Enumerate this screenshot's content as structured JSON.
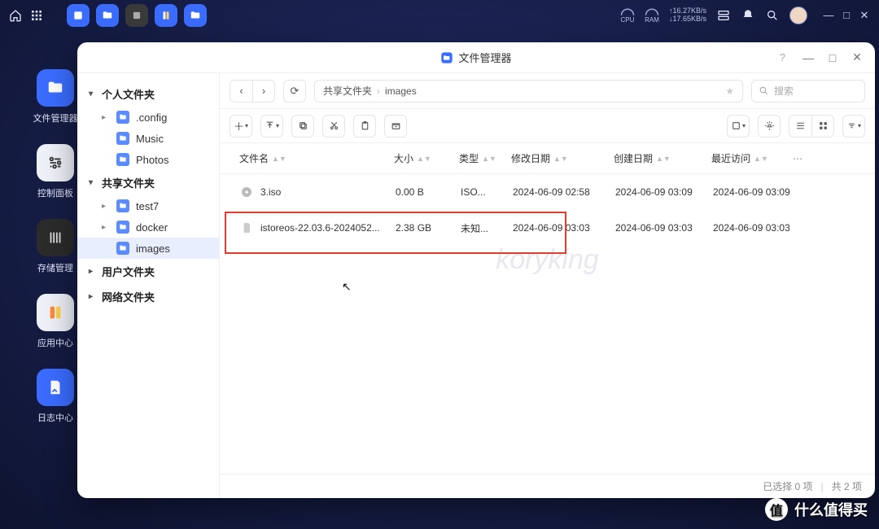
{
  "topbar": {
    "cpu_label": "CPU",
    "ram_label": "RAM",
    "net_up": "↑16.27KB/s",
    "net_down": "↓17.65KB/s"
  },
  "desktop_apps": [
    {
      "label": "文件管理器",
      "color": "#3a6cff"
    },
    {
      "label": "控制面板",
      "color": "#f2f4f8"
    },
    {
      "label": "存储管理",
      "color": "#2b2b2b"
    },
    {
      "label": "应用中心",
      "color": "#f2f4f8"
    },
    {
      "label": "日志中心",
      "color": "#3a6cff"
    }
  ],
  "window": {
    "title": "文件管理器",
    "help": "?",
    "breadcrumb": [
      "共享文件夹",
      "images"
    ],
    "search_placeholder": "搜索",
    "sidebar": {
      "sections": [
        {
          "label": "个人文件夹",
          "expanded": true,
          "items": [
            {
              "label": ".config",
              "expandable": true
            },
            {
              "label": "Music",
              "expandable": false
            },
            {
              "label": "Photos",
              "expandable": false
            }
          ]
        },
        {
          "label": "共享文件夹",
          "expanded": true,
          "items": [
            {
              "label": "test7",
              "expandable": true
            },
            {
              "label": "docker",
              "expandable": true
            },
            {
              "label": "images",
              "expandable": false,
              "active": true
            }
          ]
        },
        {
          "label": "用户文件夹",
          "expanded": false,
          "items": []
        },
        {
          "label": "网络文件夹",
          "expanded": false,
          "items": []
        }
      ]
    },
    "columns": {
      "name": "文件名",
      "size": "大小",
      "type": "类型",
      "modified": "修改日期",
      "created": "创建日期",
      "accessed": "最近访问"
    },
    "rows": [
      {
        "name": "istoreos-22.03.6-2024052...",
        "size": "2.38 GB",
        "type": "未知...",
        "modified": "2024-06-09 03:03",
        "created": "2024-06-09 03:03",
        "accessed": "2024-06-09 03:03",
        "icon": "file"
      },
      {
        "name": "3.iso",
        "size": "0.00 B",
        "type": "ISO...",
        "modified": "2024-06-09 02:58",
        "created": "2024-06-09 03:09",
        "accessed": "2024-06-09 03:09",
        "icon": "disc"
      }
    ],
    "status": {
      "selected": "已选择 0 项",
      "total": "共 2 项"
    },
    "watermark": "koryking"
  },
  "brand": "什么值得买"
}
